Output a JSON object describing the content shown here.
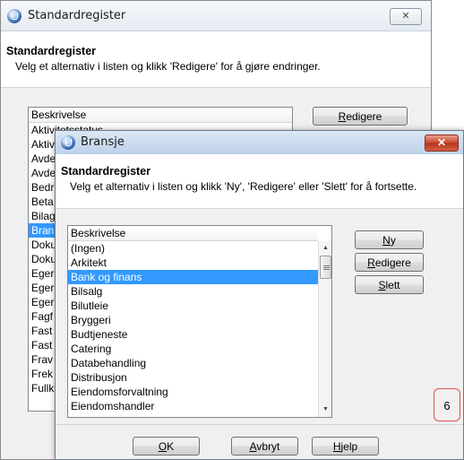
{
  "background_window": {
    "title": "Standardregister",
    "close_glyph": "✕",
    "header_title": "Standardregister",
    "header_subtitle": "Velg et alternativ i listen og klikk 'Redigere' for å gjøre endringer.",
    "column_header": "Beskrivelse",
    "edit_label": "Redigere",
    "edit_mnemonic": "R",
    "items": [
      "Aktivitetsstatus",
      "Aktiv",
      "Avde",
      "Avde",
      "Bedr",
      "Beta",
      "Bilag",
      "Bran",
      "Doku",
      "Doku",
      "Eger",
      "Eger",
      "Eger",
      "Fagf",
      "Fast",
      "Fast",
      "Frav",
      "Frek",
      "Fullk"
    ],
    "selected_index": 7
  },
  "dialog": {
    "title": "Bransje",
    "close_glyph": "✕",
    "header_title": "Standardregister",
    "header_subtitle": "Velg et alternativ i listen og klikk 'Ny', 'Redigere' eller 'Slett' for å fortsette.",
    "column_header": "Beskrivelse",
    "items": [
      "(Ingen)",
      "Arkitekt",
      "Bank og finans",
      "Bilsalg",
      "Bilutleie",
      "Bryggeri",
      "Budtjeneste",
      "Catering",
      "Databehandling",
      "Distribusjon",
      "Eiendomsforvaltning",
      "Eiendomshandler"
    ],
    "selected_index": 2,
    "buttons": {
      "new": {
        "mnemonic": "N",
        "rest": "y"
      },
      "edit": {
        "mnemonic": "R",
        "rest": "edigere"
      },
      "delete": {
        "mnemonic": "S",
        "rest": "lett"
      },
      "ok": {
        "mnemonic": "O",
        "rest": "K"
      },
      "cancel": {
        "mnemonic": "A",
        "rest": "vbryt"
      },
      "help": {
        "mnemonic": "H",
        "rest": "jelp"
      }
    },
    "scroll_up": "▲",
    "scroll_down": "▼",
    "count_badge": "6",
    "colors": {
      "selection": "#3399ff",
      "badge_border": "#e05050",
      "close_red": "#c9462a"
    }
  }
}
